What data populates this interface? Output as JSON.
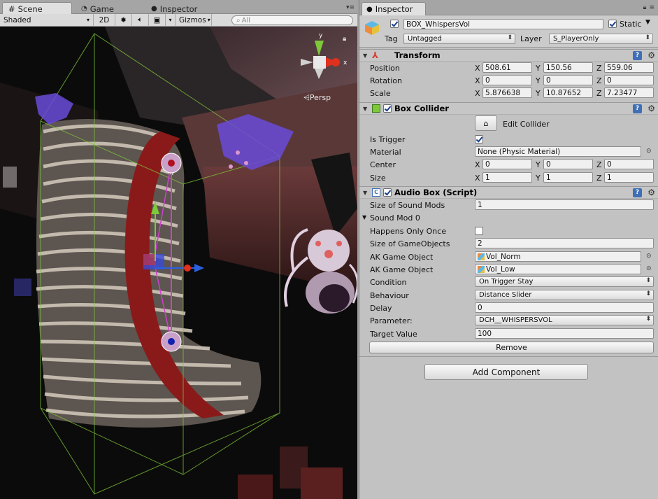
{
  "scene_panel": {
    "tabs": [
      {
        "label": "Scene",
        "icon": "hash-icon"
      },
      {
        "label": "Game",
        "icon": "pacman-icon"
      },
      {
        "label": "Inspector",
        "icon": "info-icon"
      }
    ],
    "toolbar": {
      "shading_mode": "Shaded",
      "mode_2d": "2D",
      "gizmos": "Gizmos",
      "search_placeholder": "All"
    },
    "projection_label": "Persp",
    "gizmo_axis_y": "y",
    "gizmo_axis_x": "x"
  },
  "inspector": {
    "tab_label": "Inspector",
    "object": {
      "active": true,
      "name": "BOX_WhispersVol",
      "static_label": "Static",
      "static": true,
      "tag_label": "Tag",
      "tag_value": "Untagged",
      "layer_label": "Layer",
      "layer_value": "S_PlayerOnly"
    },
    "transform": {
      "title": "Transform",
      "rows": [
        {
          "label": "Position",
          "x": "508.61",
          "y": "150.56",
          "z": "559.06"
        },
        {
          "label": "Rotation",
          "x": "0",
          "y": "0",
          "z": "0"
        },
        {
          "label": "Scale",
          "x": "5.876638",
          "y": "10.87652",
          "z": "7.23477"
        }
      ]
    },
    "box_collider": {
      "title": "Box Collider",
      "enabled": true,
      "edit_label": "Edit Collider",
      "is_trigger_label": "Is Trigger",
      "is_trigger": true,
      "material_label": "Material",
      "material_value": "None (Physic Material)",
      "center_label": "Center",
      "center": {
        "x": "0",
        "y": "0",
        "z": "0"
      },
      "size_label": "Size",
      "size": {
        "x": "1",
        "y": "1",
        "z": "1"
      }
    },
    "audio_box": {
      "title": "Audio Box (Script)",
      "enabled": true,
      "size_sound_mods_label": "Size of Sound Mods",
      "size_sound_mods": "1",
      "sound_mod_label": "Sound Mod 0",
      "happens_once_label": "Happens Only Once",
      "happens_once": false,
      "size_gameobjects_label": "Size of GameObjects",
      "size_gameobjects": "2",
      "ak_label_1": "AK Game Object",
      "ak_value_1": "Vol_Norm",
      "ak_label_2": "AK Game Object",
      "ak_value_2": "Vol_Low",
      "condition_label": "Condition",
      "condition_value": "On Trigger Stay",
      "behaviour_label": "Behaviour",
      "behaviour_value": "Distance Slider",
      "delay_label": "Delay",
      "delay_value": "0",
      "parameter_label": "Parameter:",
      "parameter_value": "DCH__WHISPERSVOL",
      "target_label": "Target Value",
      "target_value": "100",
      "remove_label": "Remove"
    },
    "add_component_label": "Add Component"
  },
  "colors": {
    "panel_bg": "#c2c2c2",
    "accent_blue": "#3f6fb6",
    "carpet_red": "#8a1a1a",
    "gizmo_green": "#7ec83a",
    "gizmo_red": "#e0301e"
  }
}
